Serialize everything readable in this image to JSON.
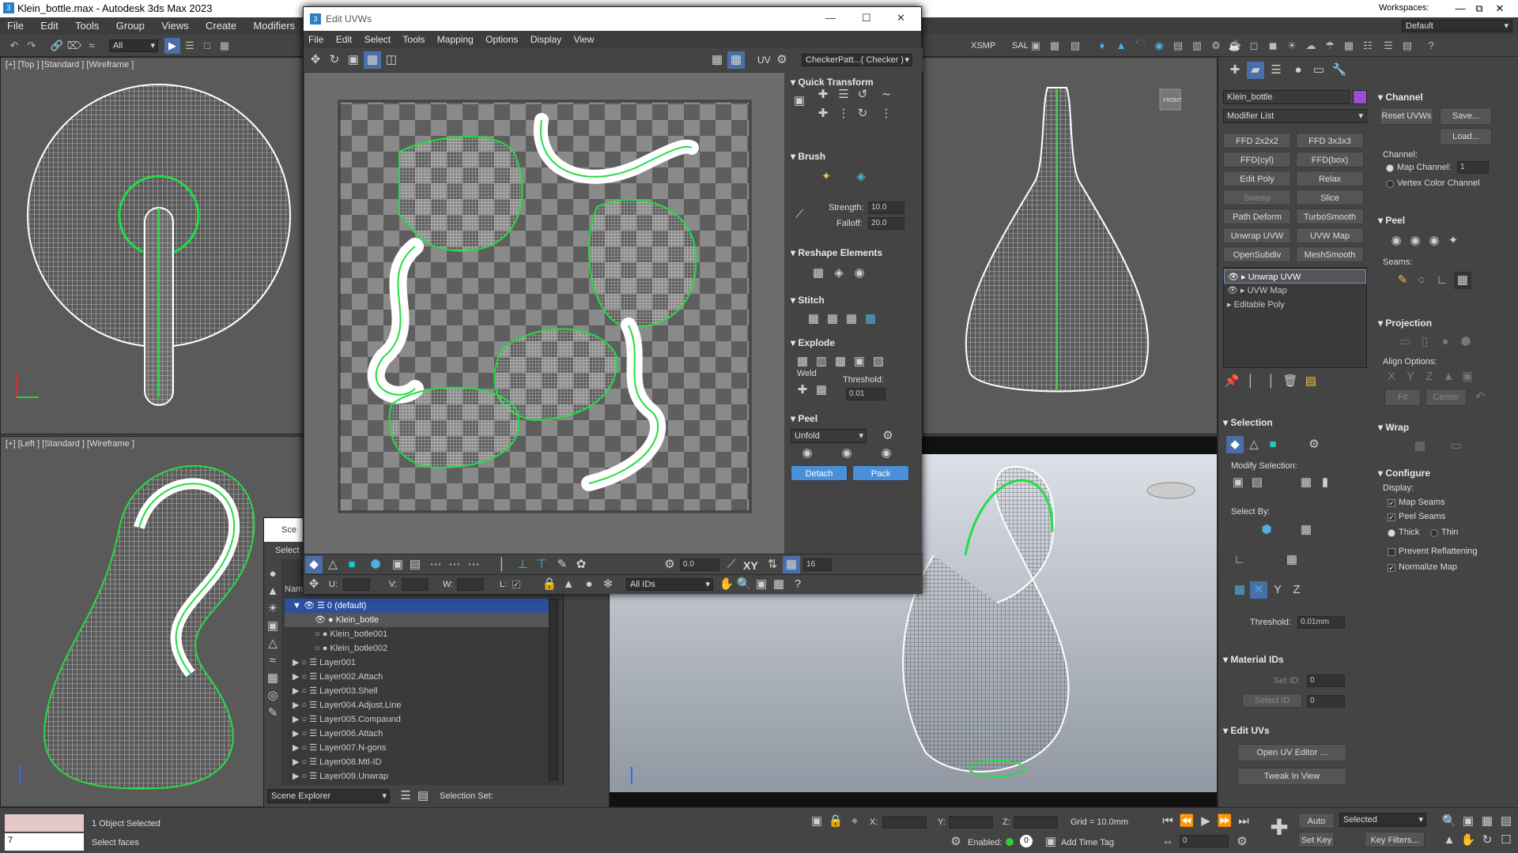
{
  "app": {
    "title": "Klein_bottle.max - Autodesk 3ds Max 2023",
    "workspace_label": "Workspaces:",
    "workspace_value": "Default"
  },
  "menus": [
    "File",
    "Edit",
    "Tools",
    "Group",
    "Views",
    "Create",
    "Modifiers"
  ],
  "toolbar": {
    "selection_filter": "All",
    "xsmp": "XSMP",
    "sal": "SAL"
  },
  "viewports": {
    "top": "[+] [Top ] [Standard ] [Wireframe ]",
    "left": "[+] [Left ] [Standard ] [Wireframe ]",
    "nav_cube_front": "FRONT"
  },
  "uv_editor": {
    "title": "Edit UVWs",
    "menus": [
      "File",
      "Edit",
      "Select",
      "Tools",
      "Mapping",
      "Options",
      "Display",
      "View"
    ],
    "uv_label": "UV",
    "checker": "CheckerPatt...( Checker )",
    "quick_transform": "Quick Transform",
    "brush": "Brush",
    "strength_label": "Strength:",
    "strength": "10.0",
    "falloff_label": "Falloff:",
    "falloff": "20.0",
    "reshape": "Reshape Elements",
    "stitch": "Stitch",
    "explode": "Explode",
    "weld": "Weld",
    "threshold_label": "Threshold:",
    "threshold": "0.01",
    "peel": "Peel",
    "unfold": "Unfold",
    "detach": "Detach",
    "pack": "Pack",
    "u_label": "U:",
    "v_label": "V:",
    "w_label": "W:",
    "l_label": "L:",
    "angle": "0.0",
    "xy": "XY",
    "grid_count": "16",
    "ids": "All IDs"
  },
  "scene_explorer": {
    "title_short": "Sce",
    "select_short": "Select",
    "name_header": "Nam",
    "rows": [
      {
        "name": "0 (default)",
        "level": 0,
        "active": true
      },
      {
        "name": "Klein_botle",
        "level": 1,
        "selected": true
      },
      {
        "name": "Klein_botle001",
        "level": 1
      },
      {
        "name": "Klein_botle002",
        "level": 1
      },
      {
        "name": "Layer001",
        "level": 0
      },
      {
        "name": "Layer002.Attach",
        "level": 0
      },
      {
        "name": "Layer003.Shell",
        "level": 0
      },
      {
        "name": "Layer004.Adjust.Line",
        "level": 0
      },
      {
        "name": "Layer005.Compaund",
        "level": 0
      },
      {
        "name": "Layer006.Attach",
        "level": 0
      },
      {
        "name": "Layer007.N-gons",
        "level": 0
      },
      {
        "name": "Layer008.Mtl-ID",
        "level": 0
      },
      {
        "name": "Layer009.Unwrap",
        "level": 0
      }
    ],
    "footer_label": "Scene Explorer",
    "selection_set": "Selection Set:"
  },
  "command_panel": {
    "object_name": "Klein_bottle",
    "modifier_list": "Modifier List",
    "modifier_buttons": [
      [
        "FFD 2x2x2",
        "FFD 3x3x3"
      ],
      [
        "FFD(cyl)",
        "FFD(box)"
      ],
      [
        "Edit Poly",
        "Relax"
      ],
      [
        "Sweep",
        "Slice"
      ],
      [
        "Path Deform",
        "TurboSmooth"
      ],
      [
        "Unwrap UVW",
        "UVW Map"
      ],
      [
        "OpenSubdiv",
        "MeshSmooth"
      ]
    ],
    "stack": [
      "Unwrap UVW",
      "UVW Map",
      "Editable Poly"
    ],
    "selection": "Selection",
    "modify_selection": "Modify Selection:",
    "select_by": "Select By:",
    "threshold_label": "Threshold:",
    "threshold": "0.01mm",
    "material_ids": "Material IDs",
    "set_id": "Set ID:",
    "set_id_value": "0",
    "select_id": "Select ID",
    "select_id_value": "0",
    "edit_uvs": "Edit UVs",
    "open_uv_editor": "Open UV Editor ...",
    "tweak_in_view": "Tweak In View",
    "channel": "Channel",
    "reset_uvws": "Reset UVWs",
    "save": "Save...",
    "load": "Load...",
    "channel_label": "Channel:",
    "map_channel": "Map Channel:",
    "map_channel_value": "1",
    "vertex_color": "Vertex Color Channel",
    "peel": "Peel",
    "seams": "Seams:",
    "projection": "Projection",
    "align_options": "Align Options:",
    "fit": "Fit",
    "center": "Center",
    "wrap": "Wrap",
    "configure": "Configure",
    "display": "Display:",
    "map_seams": "Map Seams",
    "peel_seams": "Peel Seams",
    "thick": "Thick",
    "thin": "Thin",
    "prevent_reflattening": "Prevent Reflattening",
    "normalize_map": "Normalize Map"
  },
  "status": {
    "objects_selected": "1 Object Selected",
    "prompt": "Select faces",
    "maxscript_value": "7",
    "x_label": "X:",
    "y_label": "Y:",
    "z_label": "Z:",
    "grid": "Grid = 10.0mm",
    "enabled": "Enabled:",
    "add_time_tag": "Add Time Tag",
    "auto_key": "Auto Key",
    "set_key": "Set Key",
    "selected": "Selected",
    "key_filters": "Key Filters...",
    "frame": "0"
  },
  "colors": {
    "accent": "#4a90d9",
    "seam": "#22dd44",
    "selection_blue": "#2c4f9e"
  }
}
